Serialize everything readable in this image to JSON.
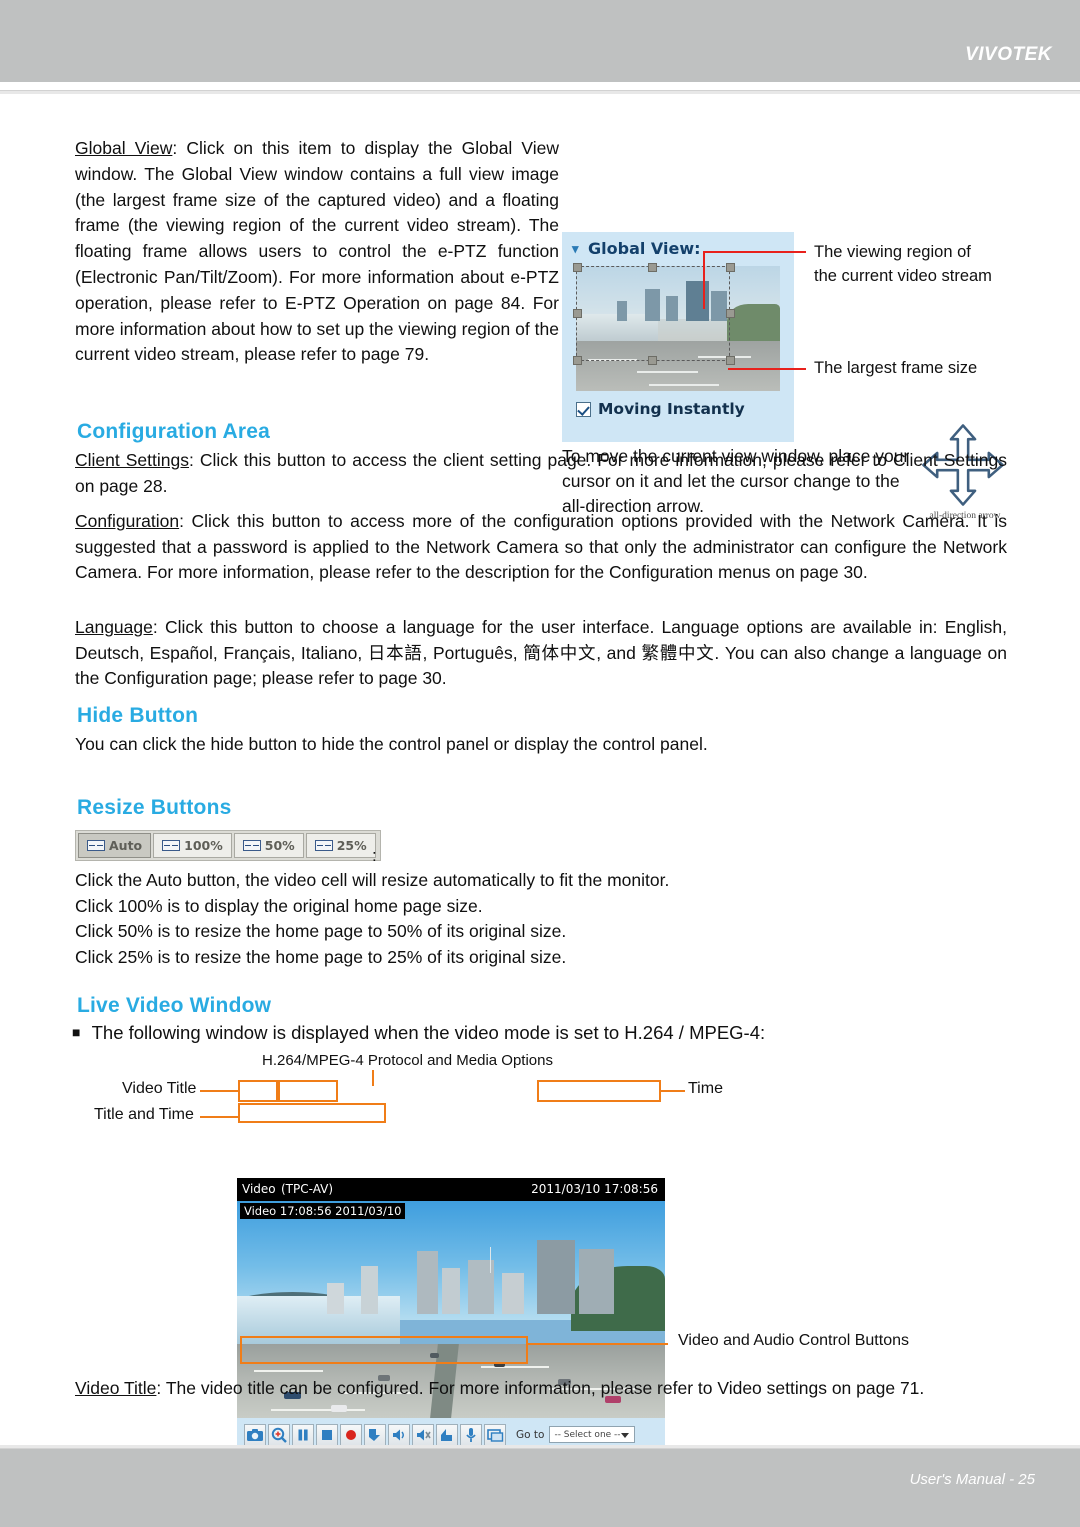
{
  "header": {
    "brand": "VIVOTEK"
  },
  "footer": {
    "text": "User's Manual - 25"
  },
  "global_view": {
    "paragraph": "Global View: Click on this item to display the Global View window. The Global View window contains a full view image (the largest frame size of the captured video) and a floating frame (the viewing region of the current video stream). The floating frame allows users to control the e-PTZ function (Electronic Pan/Tilt/Zoom). For more information about e-PTZ operation, please refer to E-PTZ Operation on page 84. For more information about how to set up the viewing region of the current video stream, please refer to page 79.",
    "term": "Global View",
    "panel_title": "Global View:",
    "checkbox_label": "Moving Instantly",
    "annotation_viewing_region": "The viewing region of the current video stream",
    "annotation_largest_frame": "The largest frame size",
    "move_note": "To move the current view window, place your cursor on it and let the cursor change to the all-direction arrow.",
    "arrow_caption": "all-direction arrow"
  },
  "configuration_area": {
    "heading": "Configuration Area",
    "client_settings_term": "Client Settings",
    "client_settings": "Client Settings: Click this button to access the client setting page. For more information, please refer to Client Settings on page 28.",
    "configuration_term": "Configuration",
    "configuration": "Configuration: Click this button to access more of the configuration options provided with the Network Camera. It is suggested that a password is applied to the Network Camera so that only the administrator can configure the Network Camera. For more information, please refer to the description for the Configuration menus on page 30.",
    "language_term": "Language",
    "language": "Language: Click this button to choose a language for the user interface. Language options are available in: English, Deutsch, Español, Français, Italiano, 日本語, Português, 簡体中文, and 繁體中文. You can also change a language on the Configuration page; please refer to page 30."
  },
  "hide_button": {
    "heading": "Hide Button",
    "text": "You can click the hide button to hide the control panel or display the control panel."
  },
  "resize_buttons": {
    "heading": "Resize Buttons",
    "buttons": [
      {
        "label": "Auto",
        "active": true
      },
      {
        "label": "100%",
        "active": false
      },
      {
        "label": "50%",
        "active": false
      },
      {
        "label": "25%",
        "active": false
      }
    ],
    "colon": ":",
    "lines": [
      "Click the Auto button, the video cell will resize automatically to fit the monitor.",
      "Click 100% is to display the original home page size.",
      "Click 50% is to resize the home page to 50% of its original size.",
      "Click 25% is to resize the home page to 25% of its original size."
    ]
  },
  "live_video_window": {
    "heading": "Live Video Window",
    "bullet": "The following window is displayed when the video mode is set to H.264 / MPEG-4:",
    "protocol_caption": "H.264/MPEG-4 Protocol and Media Options",
    "label_video_title": "Video Title",
    "label_title_and_time": "Title and Time",
    "label_time": "Time",
    "label_controls": "Video and Audio Control Buttons",
    "video": {
      "title": "Video",
      "protocol": "(TPC-AV)",
      "timestamp": "2011/03/10  17:08:56",
      "overlay_title_time": "Video 17:08:56  2011/03/10",
      "goto_label": "Go to",
      "goto_value": "-- Select one --",
      "control_icons": [
        "snapshot-camera-icon",
        "digital-zoom-icon",
        "pause-icon",
        "stop-icon",
        "record-icon",
        "save-video-icon",
        "volume-icon",
        "mute-icon",
        "upload-icon",
        "talk-microphone-icon",
        "full-screen-icon"
      ]
    },
    "video_title_term": "Video Title",
    "video_title_text": "Video Title: The video title can be configured. For more information, please refer to Video settings on page 71."
  },
  "colors": {
    "accent_heading": "#29abe2",
    "header_bar": "#bfc1c1",
    "callout_orange": "#f07d18",
    "callout_red": "#e8211c",
    "panel_blue": "#cfe6f5"
  }
}
